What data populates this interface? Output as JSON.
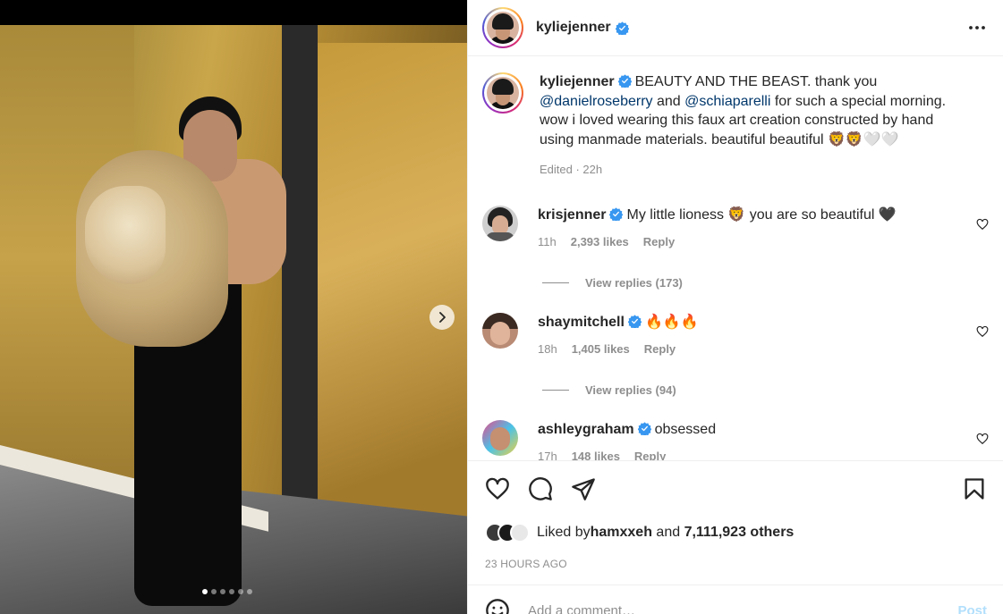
{
  "post": {
    "author": "kyliejenner",
    "carousel": {
      "slide_count": 6,
      "active_index": 0
    }
  },
  "header": {
    "username": "kyliejenner",
    "more_icon": "more-horizontal-icon"
  },
  "caption": {
    "username": "kyliejenner",
    "text_1": "BEAUTY AND THE BEAST. thank you ",
    "mention_1": "@danielroseberry",
    "text_2": " and ",
    "mention_2": "@schiaparelli",
    "text_3": " for such a special morning. wow i loved wearing this faux art creation constructed by hand using manmade materials. beautiful beautiful 🦁🦁🤍🤍",
    "edited": "Edited · 22h"
  },
  "comments": [
    {
      "username": "krisjenner",
      "text": "My little lioness 🦁 you are so beautiful 🖤",
      "time": "11h",
      "likes": "2,393 likes",
      "reply": "Reply",
      "view_replies": "View replies (173)"
    },
    {
      "username": "shaymitchell",
      "text": "🔥🔥🔥",
      "time": "18h",
      "likes": "1,405 likes",
      "reply": "Reply",
      "view_replies": "View replies (94)"
    },
    {
      "username": "ashleygraham",
      "text": "obsessed",
      "time": "17h",
      "likes": "148 likes",
      "reply": "Reply"
    }
  ],
  "actions": {
    "like_icon": "heart-icon",
    "comment_icon": "comment-icon",
    "share_icon": "paper-plane-icon",
    "save_icon": "bookmark-icon"
  },
  "likes": {
    "prefix": "Liked by ",
    "user": "hamxxeh",
    "middle": " and ",
    "count": "7,111,923 others"
  },
  "timestamp": "23 HOURS AGO",
  "add_comment": {
    "placeholder": "Add a comment…",
    "post_label": "Post",
    "emoji_icon": "smiley-icon"
  },
  "colors": {
    "verified": "#3897f0",
    "link": "#00376b",
    "muted": "#8e8e8e",
    "post_disabled": "#b2dffc"
  }
}
